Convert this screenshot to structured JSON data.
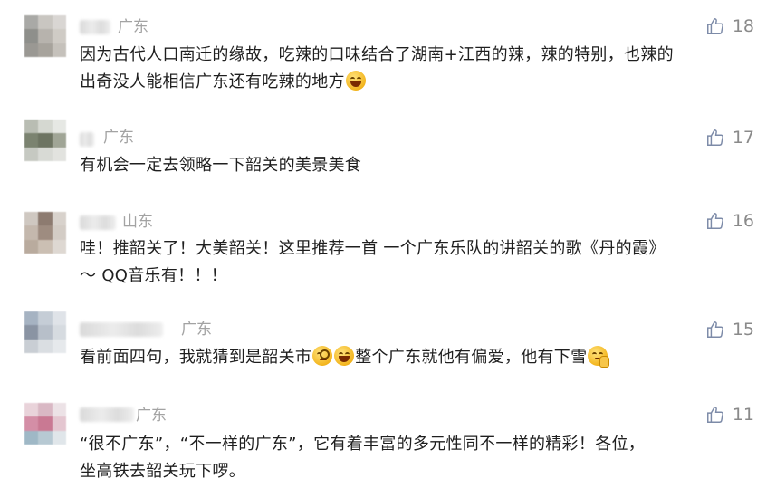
{
  "comments": [
    {
      "location": "广东",
      "likes": "18",
      "lines": [
        "因为古代人口南迁的缘故，吃辣的口味结合了湖南+江西的辣，辣的特别，也辣的",
        "出奇没人能相信广东还有吃辣的地方"
      ],
      "emoji": [
        "laughing-crying-emoji"
      ]
    },
    {
      "location": "广东",
      "likes": "17",
      "lines": [
        "有机会一定去领略一下韶关的美景美食"
      ]
    },
    {
      "location": "山东",
      "likes": "16",
      "lines": [
        "哇！推韶关了！大美韶关！这里推荐一首  一个广东乐队的讲韶关的歌《丹的霞》",
        "～ QQ音乐有！！！"
      ]
    },
    {
      "location": "广东",
      "likes": "15",
      "line_parts": [
        "看前面四句，我就猜到是韶关市",
        "整个广东就他有偏爱，他有下雪"
      ],
      "emoji": [
        "thinking-face-emoji",
        "laughing-crying-emoji",
        "shushing-face-emoji"
      ]
    },
    {
      "location": "广东",
      "likes": "11",
      "lines": [
        "“很不广东”，“不一样的广东”，它有着丰富的多元性同不一样的精彩！各位，",
        "坐高铁去韶关玩下啰。"
      ]
    }
  ],
  "colors": {
    "text": "#1f1f1f",
    "meta": "#a3a3a3",
    "likes": "#8a8a8a",
    "background": "#ffffff"
  },
  "icons": {
    "like": "thumbs-up-outline-icon"
  }
}
